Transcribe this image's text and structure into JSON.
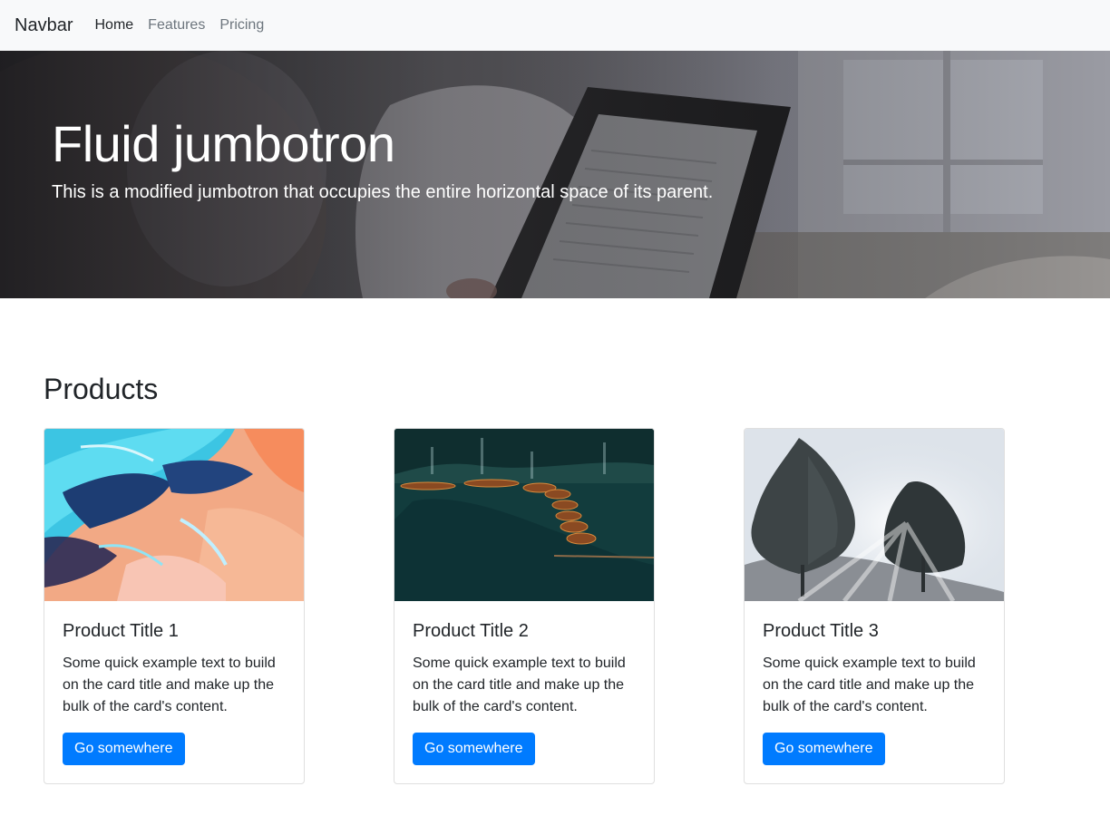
{
  "navbar": {
    "brand": "Navbar",
    "links": [
      {
        "label": "Home",
        "active": true
      },
      {
        "label": "Features",
        "active": false
      },
      {
        "label": "Pricing",
        "active": false
      }
    ]
  },
  "hero": {
    "title": "Fluid jumbotron",
    "lead": "This is a modified jumbotron that occupies the entire horizontal space of its parent."
  },
  "products": {
    "title": "Products",
    "cards": [
      {
        "title": "Product Title 1",
        "text": "Some quick example text to build on the card title and make up the bulk of the card's content.",
        "button": "Go somewhere",
        "image": "abstract-painting"
      },
      {
        "title": "Product Title 2",
        "text": "Some quick example text to build on the card title and make up the bulk of the card's content.",
        "button": "Go somewhere",
        "image": "boats-on-lake"
      },
      {
        "title": "Product Title 3",
        "text": "Some quick example text to build on the card title and make up the bulk of the card's content.",
        "button": "Go somewhere",
        "image": "misty-trees"
      }
    ]
  },
  "colors": {
    "primary": "#007bff",
    "navbar_bg": "#f8f9fa",
    "muted_link": "#6c757d"
  }
}
